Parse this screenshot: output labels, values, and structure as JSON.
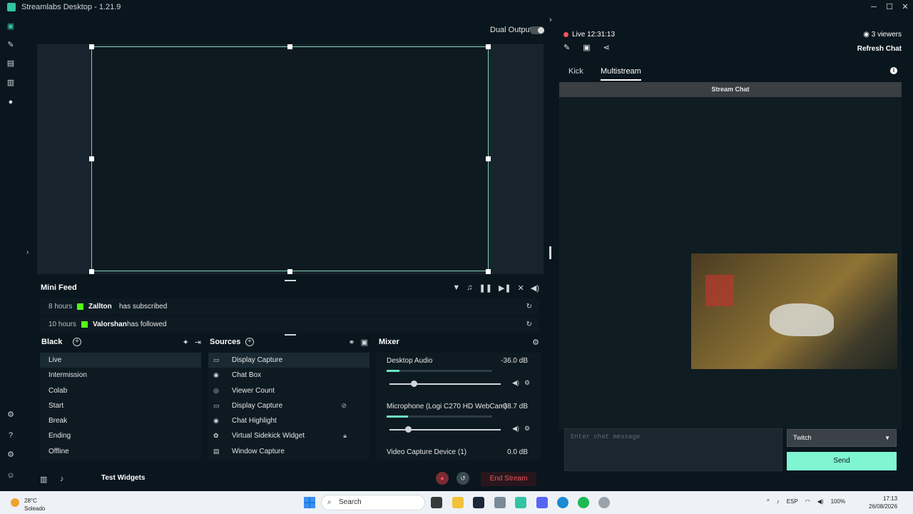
{
  "app": {
    "title": "Streamlabs Desktop - 1.21.9"
  },
  "window_controls": {
    "minimize": "─",
    "maximize": "☐",
    "close": "✕"
  },
  "editor": {
    "dual_output_label": "Dual Output"
  },
  "mini_feed": {
    "title": "Mini Feed",
    "events": [
      {
        "time": "8 hours",
        "user": "Zallton",
        "action": "has subscribed"
      },
      {
        "time": "10 hours",
        "user": "Valorshan",
        "action": "has followed"
      }
    ]
  },
  "scenes": {
    "title": "Black",
    "items": [
      "Live",
      "Intermission",
      "Colab",
      "Start",
      "Break",
      "Ending",
      "Offline"
    ],
    "selected": "Live"
  },
  "sources": {
    "title": "Sources",
    "items": [
      "Display Capture",
      "Chat Box",
      "Viewer Count",
      "Display Capture",
      "Chat Highlight",
      "Virtual Sidekick Widget",
      "Window Capture"
    ]
  },
  "mixer": {
    "title": "Mixer",
    "channels": [
      {
        "name": "Desktop Audio",
        "db": "-36.0 dB"
      },
      {
        "name": "Microphone (Logi C270 HD WebCam)",
        "db": "-38.7 dB"
      },
      {
        "name": "Video Capture Device (1)",
        "db": "0.0 dB"
      }
    ]
  },
  "footer": {
    "test_widgets": "Test Widgets",
    "end_stream": "End Stream"
  },
  "stream": {
    "live_label": "Live 12:31:13",
    "viewers": "3 viewers",
    "refresh_chat": "Refresh Chat",
    "tabs": [
      "Kick",
      "Multistream"
    ],
    "active_tab": "Multistream",
    "chat_header": "Stream Chat",
    "chat_placeholder": "Enter chat message",
    "platform": "Twitch",
    "send": "Send"
  },
  "taskbar": {
    "weather_temp": "28°C",
    "weather_desc": "Soleado",
    "search_placeholder": "Search",
    "lang": "ESP",
    "battery": "100%",
    "time": "17:13",
    "date": "26/08/2026"
  },
  "colors": {
    "accent": "#80f5d2",
    "live_red": "#f1545c",
    "kick_green": "#53fc18",
    "bg": "#09161d"
  }
}
